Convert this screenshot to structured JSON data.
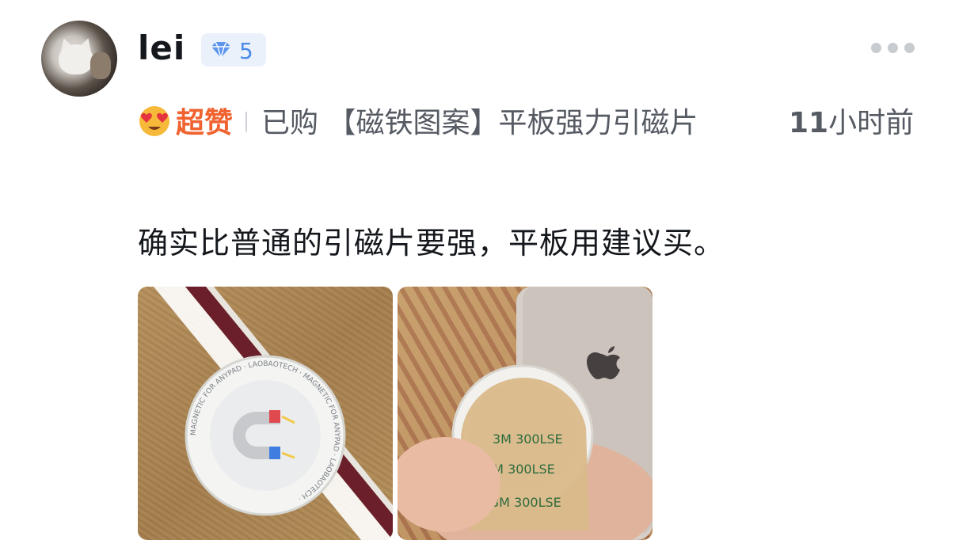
{
  "user": {
    "name": "lei",
    "level": "5"
  },
  "review": {
    "rating_label": "超赞",
    "purchase_prefix": "已购",
    "product": "【磁铁图案】平板强力引磁片",
    "time_num": "11",
    "time_unit": "小时前",
    "content": "确实比普通的引磁片要强，平板用建议买。"
  },
  "photos": {
    "photo1_text": "MAGNETIC FOR ANYPAD · LAOBAOTECH · MAGNETIC FOR ANYPAD · LAOBAOTECH ·",
    "photo2_labels": [
      "3M 300LSE",
      "3M 300LSE",
      "3M 300LSE"
    ]
  },
  "icons": {
    "level": "diamond-icon",
    "more": "more-icon",
    "rating": "heart-eyes-emoji-icon"
  },
  "colors": {
    "rating": "#f0622f",
    "level": "#4b8ae8",
    "level_bg": "#eaf1fb"
  }
}
